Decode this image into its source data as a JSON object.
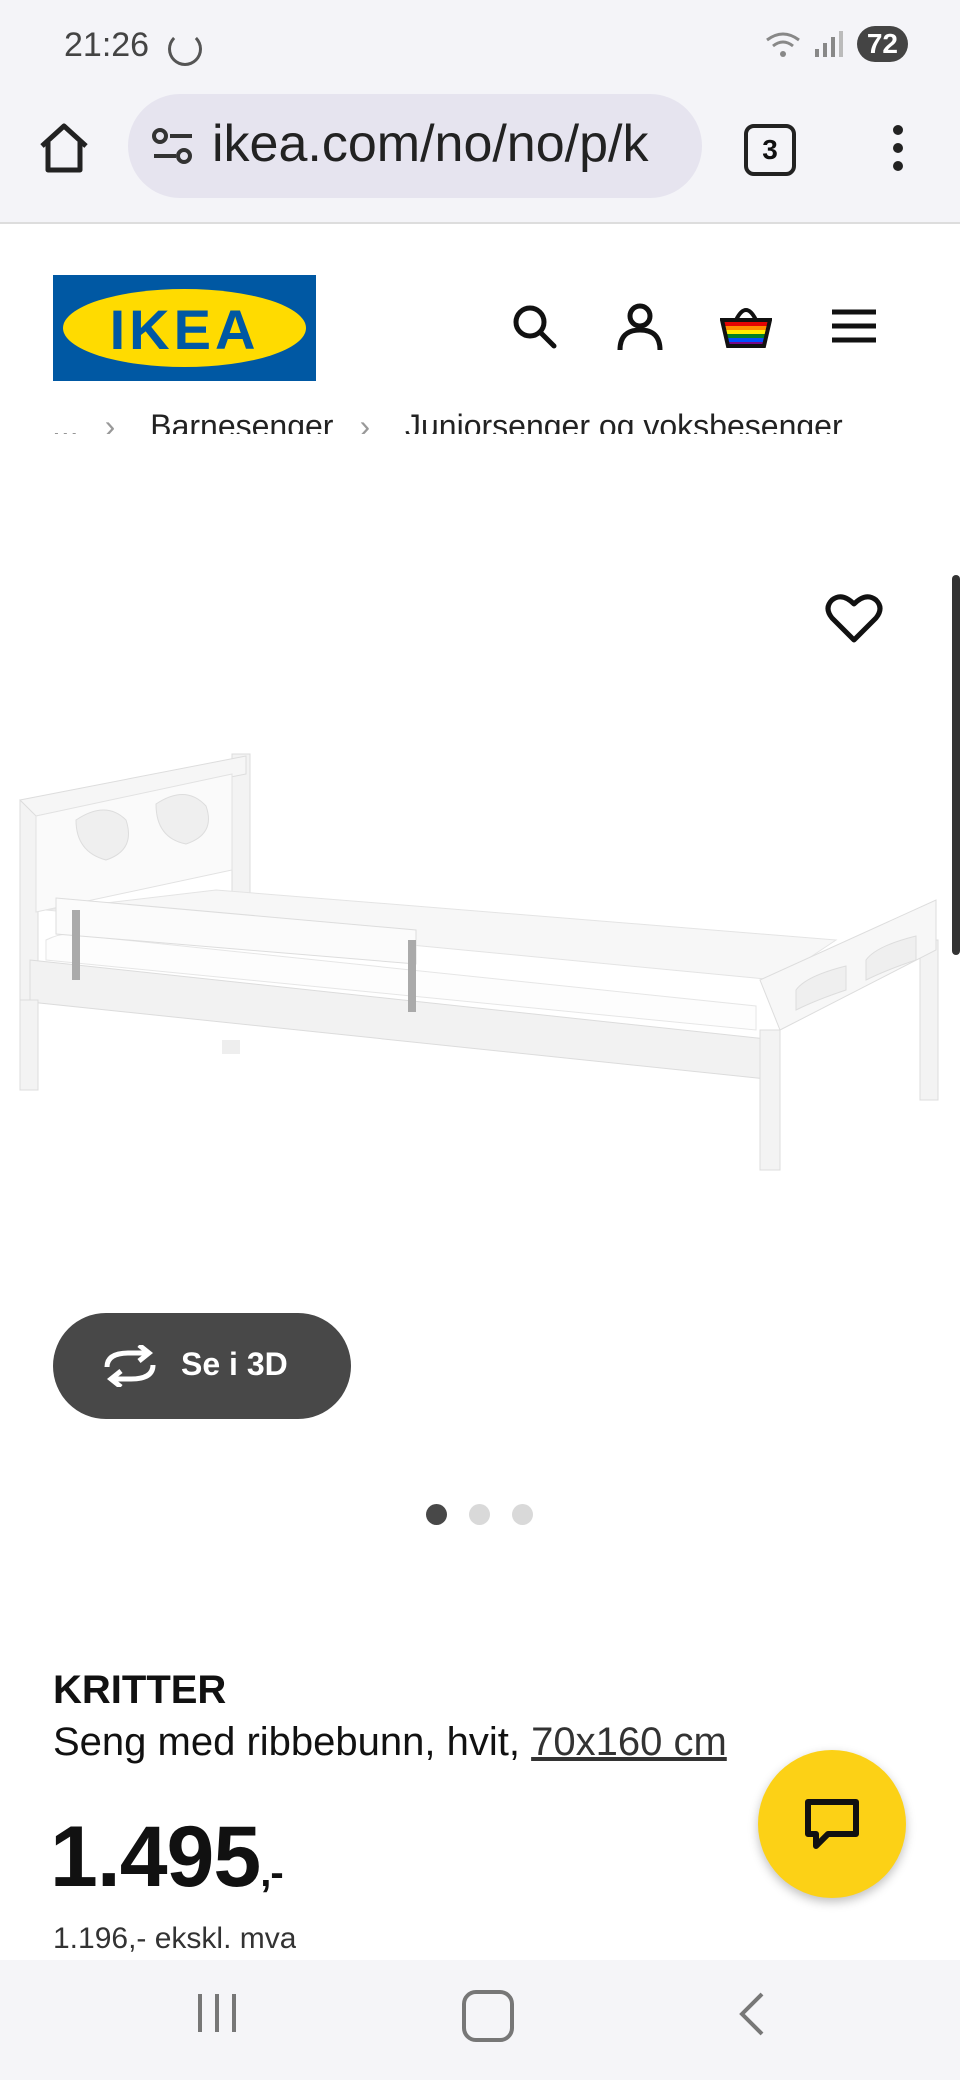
{
  "status": {
    "time": "21:26",
    "battery": "72"
  },
  "browser": {
    "url": "ikea.com/no/no/p/k",
    "tab_count": "3"
  },
  "header": {
    "logo_text": "IKEA"
  },
  "breadcrumbs": [
    "...",
    "Barnesenger",
    "Juniorsenger og voksbesenger"
  ],
  "product": {
    "button_3d": "Se i 3D",
    "image_dots": 3,
    "active_dot": 1,
    "name": "KRITTER",
    "description": "Seng med ribbebunn, hvit,",
    "size": "70x160 cm",
    "price": "1.495",
    "price_suffix": ",-",
    "price_excl": "1.196,- ekskl. mva"
  },
  "colors": {
    "ikea_blue": "#0058a3",
    "ikea_yellow": "#ffdb00",
    "chat_yellow": "#fcd116"
  },
  "icons": [
    "spinner-icon",
    "wifi-icon",
    "signal-icon",
    "home-icon",
    "site-settings-icon",
    "tabs-icon",
    "more-icon",
    "search-icon",
    "account-icon",
    "cart-icon",
    "hamburger-icon",
    "heart-icon",
    "rotate-3d-icon",
    "chat-icon"
  ]
}
